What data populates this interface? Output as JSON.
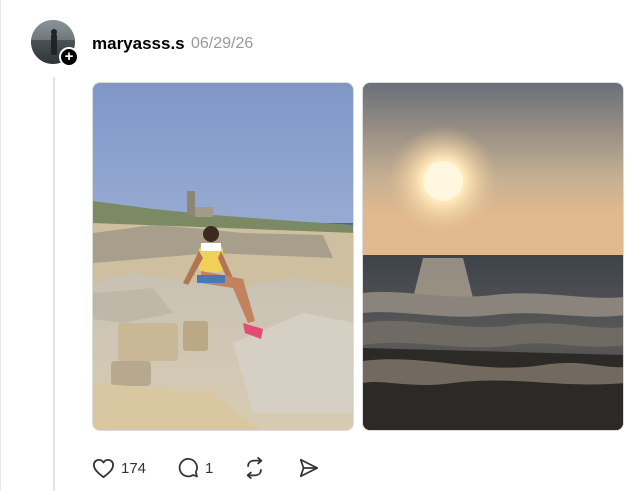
{
  "post": {
    "author": "maryasss.s",
    "date": "06/29/26",
    "follow_symbol": "+",
    "images": [
      {
        "icon": "photo-girl-on-rocks"
      },
      {
        "icon": "photo-sunset-sea"
      }
    ],
    "actions": {
      "likes": "174",
      "replies": "1"
    }
  }
}
